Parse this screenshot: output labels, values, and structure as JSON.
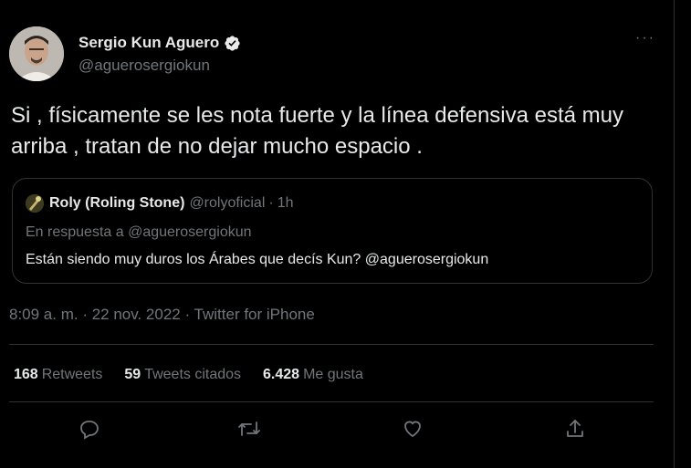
{
  "author": {
    "name": "Sergio Kun Aguero",
    "handle": "@aguerosergiokun"
  },
  "more_label": "···",
  "tweet_text": "Si , físicamente se les nota fuerte y la línea defensiva está muy arriba , tratan de no dejar mucho espacio .",
  "quote": {
    "name": "Roly (Roling Stone)",
    "handle": "@rolyoficial",
    "separator": "·",
    "time": "1h",
    "reply_to": "En respuesta a @aguerosergiokun",
    "text": "Están siendo muy duros los Árabes que decís Kun? @aguerosergiokun"
  },
  "meta": "8:09 a. m. · 22 nov. 2022 · Twitter for iPhone",
  "stats": {
    "retweets_count": "168",
    "retweets_label": "Retweets",
    "quotes_count": "59",
    "quotes_label": "Tweets citados",
    "likes_count": "6.428",
    "likes_label": "Me gusta"
  },
  "colors": {
    "background": "#000000",
    "text": "#e7e9ea",
    "secondary": "#71767b",
    "border": "#2f3336",
    "verified": "#e7e9ea"
  },
  "icons": {
    "reply": "reply-icon",
    "retweet": "retweet-icon",
    "like": "heart-icon",
    "share": "share-icon"
  }
}
